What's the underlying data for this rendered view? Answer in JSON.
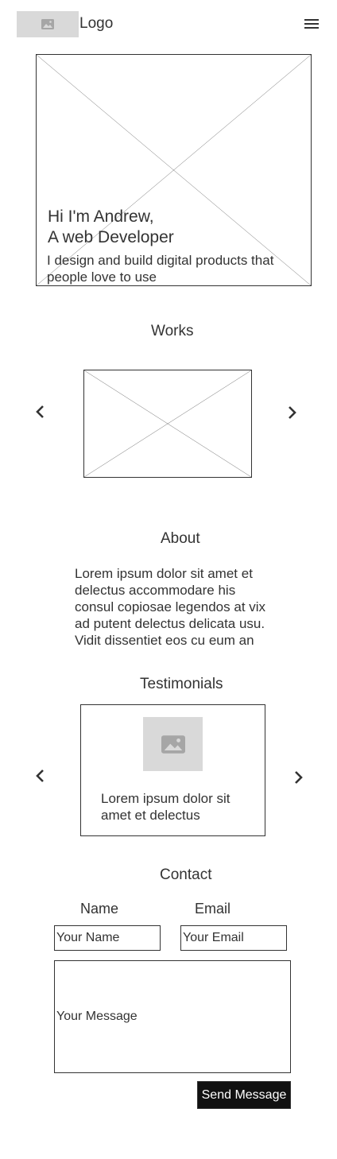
{
  "header": {
    "logo_icon": "image-icon",
    "logo_text": "Logo",
    "menu_icon": "hamburger-menu-icon"
  },
  "hero": {
    "heading_line1": "Hi I'm Andrew,",
    "heading_line2": "A web Developer",
    "subtitle_line1": "I design and build digital products that",
    "subtitle_line2": "people love to use"
  },
  "works": {
    "title": "Works",
    "prev_icon": "chevron-left-icon",
    "next_icon": "chevron-right-icon"
  },
  "about": {
    "title": "About",
    "lines": [
      "Lorem ipsum dolor sit amet et",
      "delectus accommodare his",
      "consul copiosae legendos at vix",
      "ad putent delectus delicata usu.",
      "Vidit dissentiet eos cu eum an"
    ]
  },
  "testimonials": {
    "title": "Testimonials",
    "image_icon": "image-icon",
    "text_line1": "Lorem ipsum dolor sit",
    "text_line2": "amet et delectus",
    "prev_icon": "chevron-left-icon",
    "next_icon": "chevron-right-icon"
  },
  "contact": {
    "title": "Contact",
    "name_label": "Name",
    "email_label": "Email",
    "name_placeholder": "Your Name",
    "email_placeholder": "Your Email",
    "message_placeholder": "Your Message",
    "send_label": "Send Message"
  },
  "colors": {
    "text": "#333333",
    "placeholder_fill": "#d9d9d9",
    "button_bg": "#111111",
    "button_text": "#ffffff"
  }
}
